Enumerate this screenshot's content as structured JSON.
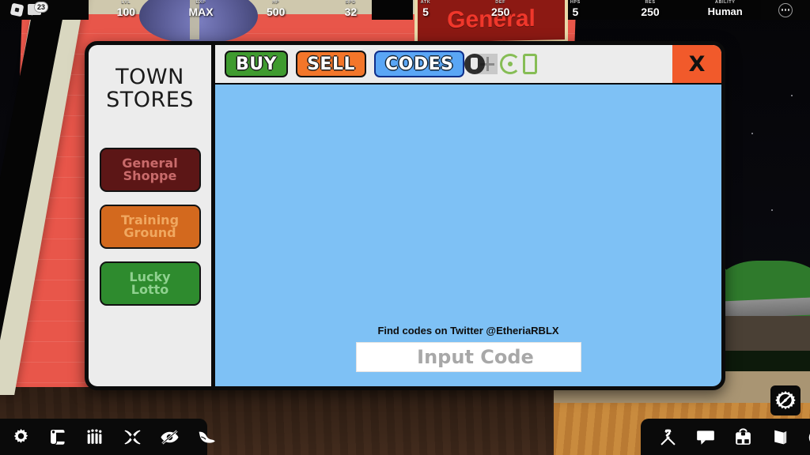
{
  "hud": {
    "left_icons": [
      {
        "name": "roblox-logo-icon",
        "label": "Roblox"
      },
      {
        "name": "chat-icon",
        "label": "Chat",
        "badge": "23"
      }
    ],
    "stats": [
      {
        "label": "LVL",
        "value": "100"
      },
      {
        "label": "EXP",
        "value": "MAX"
      },
      {
        "label": "HP",
        "value": "500"
      },
      {
        "label": "SPD",
        "value": "32"
      },
      {
        "label": "ATK",
        "value": "5"
      },
      {
        "label": "DEF",
        "value": "250"
      },
      {
        "label": "HPS",
        "value": "5"
      },
      {
        "label": "RES",
        "value": "250"
      },
      {
        "label": "ABILITY",
        "value": "Human"
      }
    ],
    "more_menu": "…"
  },
  "world": {
    "shop_sign_text": "General"
  },
  "panel": {
    "sidebar": {
      "title_line1": "TOWN",
      "title_line2": "STORES",
      "buttons": [
        {
          "label_line1": "General",
          "label_line2": "Shoppe",
          "color": "#5c1616",
          "text_color": "#c96b6b"
        },
        {
          "label_line1": "Training",
          "label_line2": "Ground",
          "color": "#d3691e",
          "text_color": "#f0a860"
        },
        {
          "label_line1": "Lucky",
          "label_line2": "Lotto",
          "color": "#2e8b2e",
          "text_color": "#8fd18f"
        }
      ]
    },
    "tabs": [
      {
        "label": "BUY",
        "color": "#3f9b2f",
        "active": false
      },
      {
        "label": "SELL",
        "color": "#f3762a",
        "active": false
      },
      {
        "label": "CODES",
        "color": "#5aa6f5",
        "active": true
      }
    ],
    "currency_icon": "add-currency-icon",
    "close_label": "X",
    "content": {
      "twitter_note": "Find codes on Twitter @EtheriaRBLX",
      "input_placeholder": "Input Code",
      "input_value": ""
    }
  },
  "toolbar_left": [
    {
      "name": "settings-gear-icon",
      "label": "Settings"
    },
    {
      "name": "quest-scroll-icon",
      "label": "Quests"
    },
    {
      "name": "party-group-icon",
      "label": "Party"
    },
    {
      "name": "crossed-swords-icon",
      "label": "Combat"
    },
    {
      "name": "eye-slash-icon",
      "label": "Hide UI"
    },
    {
      "name": "winged-boot-icon",
      "label": "Speed"
    }
  ],
  "toolbar_right": [
    {
      "name": "pickaxe-hammer-icon",
      "label": "Tools"
    },
    {
      "name": "chat-bubble-icon",
      "label": "Chat"
    },
    {
      "name": "backpack-icon",
      "label": "Inventory"
    },
    {
      "name": "book-icon",
      "label": "Codex"
    },
    {
      "name": "emote-icon",
      "label": "Emotes"
    }
  ],
  "compass": {
    "name": "compass-icon",
    "label": "Compass"
  },
  "colors": {
    "panel_content_bg": "#7ec1f5",
    "panel_chrome_bg": "#ececec",
    "close_btn": "#f15a2b",
    "buy": "#3f9b2f",
    "sell": "#f3762a",
    "codes": "#5aa6f5"
  }
}
